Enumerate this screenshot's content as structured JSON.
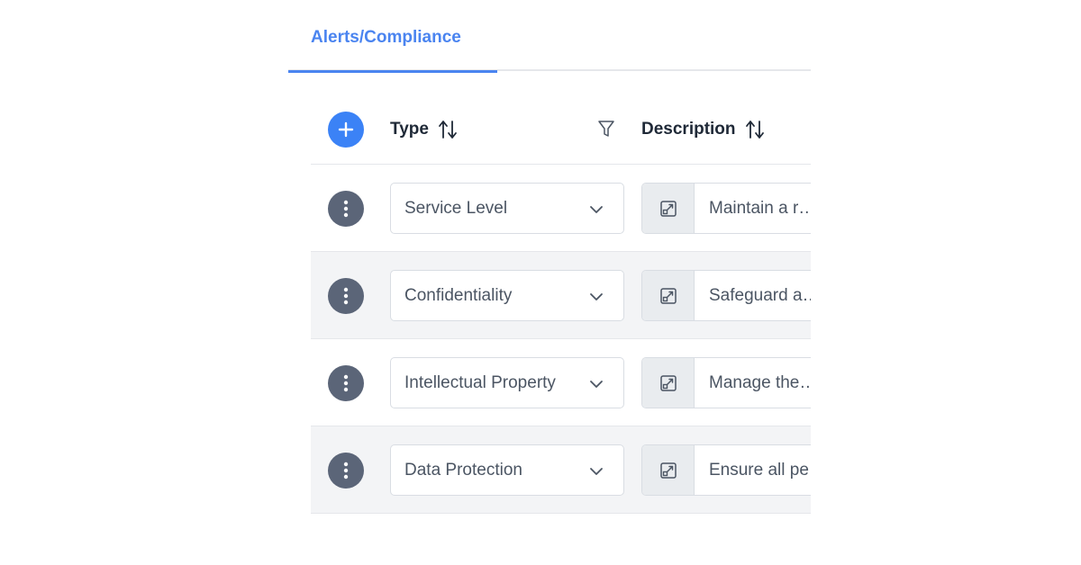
{
  "tabs": [
    {
      "label": "Alerts/Compliance",
      "active": true
    }
  ],
  "table": {
    "columns": {
      "type": "Type",
      "description": "Description"
    },
    "rows": [
      {
        "type": "Service Level",
        "description": "Maintain a r… for all critica…"
      },
      {
        "type": "Confidentiality",
        "description": "Safeguard a… received fro…"
      },
      {
        "type": "Intellectual Property",
        "description": "Manage the… per the cont…"
      },
      {
        "type": "Data Protection",
        "description": "Ensure all pe… compliance …"
      }
    ]
  },
  "icons": {
    "add": "plus-icon",
    "row_menu": "vertical-dots-icon",
    "sort": "sort-arrows-icon",
    "filter": "filter-funnel-icon",
    "select": "chevron-down-icon",
    "expand": "expand-arrow-icon"
  },
  "colors": {
    "accent": "#4a84f0",
    "add_button": "#3b82f6",
    "menu_button": "#5b6578",
    "alt_row": "#f3f4f6"
  }
}
